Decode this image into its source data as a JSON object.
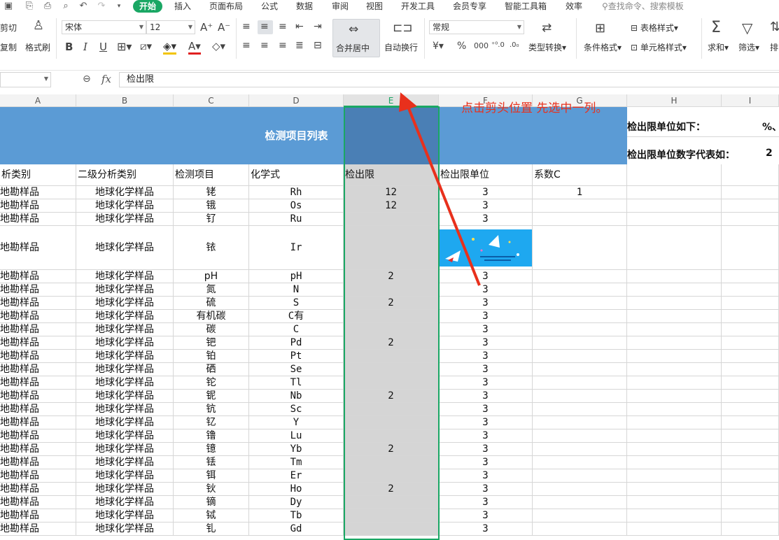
{
  "menubar": {
    "items": [
      "开始",
      "插入",
      "页面布局",
      "公式",
      "数据",
      "审阅",
      "视图",
      "开发工具",
      "会员专享",
      "智能工具箱",
      "效率"
    ],
    "active_index": 0,
    "search_placeholder": "查找命令、搜索模板"
  },
  "ribbon": {
    "cut": "剪切",
    "copy": "复制",
    "format_painter": "格式刷",
    "font_name": "宋体",
    "font_size": "12",
    "merge_center": "合并居中",
    "wrap_text": "自动换行",
    "number_format": "常规",
    "type_convert": "类型转换",
    "conditional_format": "条件格式",
    "table_style": "表格样式",
    "cell_style": "单元格样式",
    "sum": "求和",
    "filter": "筛选",
    "sort": "排"
  },
  "formula_bar": {
    "content": "检出限"
  },
  "columns": [
    "A",
    "B",
    "C",
    "D",
    "E",
    "F",
    "G",
    "H",
    "I"
  ],
  "selected_column": "E",
  "sheet": {
    "title": "检测项目列表",
    "headers": [
      "析类别",
      "二级分析类别",
      "检测项目",
      "化学式",
      "检出限",
      "检出限单位",
      "系数C"
    ],
    "notes": [
      "检出限单位如下：",
      "%、",
      "检出限单位数字代表如：",
      "2"
    ],
    "annotation": "点击剪头位置 先选中一列。",
    "rows": [
      [
        "地勘样品",
        "地球化学样品",
        "铑",
        "Rh",
        "12",
        "3",
        "1"
      ],
      [
        "地勘样品",
        "地球化学样品",
        "锇",
        "Os",
        "12",
        "3",
        ""
      ],
      [
        "地勘样品",
        "地球化学样品",
        "钌",
        "Ru",
        "",
        "3",
        ""
      ],
      [
        "地勘样品",
        "地球化学样品",
        "铱",
        "Ir",
        "",
        "",
        ""
      ],
      [
        "地勘样品",
        "地球化学样品",
        "pH",
        "pH",
        "2",
        "3",
        ""
      ],
      [
        "地勘样品",
        "地球化学样品",
        "氮",
        "N",
        "",
        "3",
        ""
      ],
      [
        "地勘样品",
        "地球化学样品",
        "硫",
        "S",
        "2",
        "3",
        ""
      ],
      [
        "地勘样品",
        "地球化学样品",
        "有机碳",
        "C有",
        "",
        "3",
        ""
      ],
      [
        "地勘样品",
        "地球化学样品",
        "碳",
        "C",
        "",
        "3",
        ""
      ],
      [
        "地勘样品",
        "地球化学样品",
        "钯",
        "Pd",
        "2",
        "3",
        ""
      ],
      [
        "地勘样品",
        "地球化学样品",
        "铂",
        "Pt",
        "",
        "3",
        ""
      ],
      [
        "地勘样品",
        "地球化学样品",
        "硒",
        "Se",
        "",
        "3",
        ""
      ],
      [
        "地勘样品",
        "地球化学样品",
        "铊",
        "Tl",
        "",
        "3",
        ""
      ],
      [
        "地勘样品",
        "地球化学样品",
        "铌",
        "Nb",
        "2",
        "3",
        ""
      ],
      [
        "地勘样品",
        "地球化学样品",
        "钪",
        "Sc",
        "",
        "3",
        ""
      ],
      [
        "地勘样品",
        "地球化学样品",
        "钇",
        "Y",
        "",
        "3",
        ""
      ],
      [
        "地勘样品",
        "地球化学样品",
        "镥",
        "Lu",
        "",
        "3",
        ""
      ],
      [
        "地勘样品",
        "地球化学样品",
        "镱",
        "Yb",
        "2",
        "3",
        ""
      ],
      [
        "地勘样品",
        "地球化学样品",
        "铥",
        "Tm",
        "",
        "3",
        ""
      ],
      [
        "地勘样品",
        "地球化学样品",
        "铒",
        "Er",
        "",
        "3",
        ""
      ],
      [
        "地勘样品",
        "地球化学样品",
        "钬",
        "Ho",
        "2",
        "3",
        ""
      ],
      [
        "地勘样品",
        "地球化学样品",
        "镝",
        "Dy",
        "",
        "3",
        ""
      ],
      [
        "地勘样品",
        "地球化学样品",
        "铽",
        "Tb",
        "",
        "3",
        ""
      ],
      [
        "地勘样品",
        "地球化学样品",
        "钆",
        "Gd",
        "",
        "3",
        ""
      ]
    ]
  },
  "colors": {
    "accent_green": "#1aa764",
    "banner_blue": "#5b9bd5",
    "annotation_red": "#e8301c",
    "selected_fill": "#d5d5d5"
  }
}
